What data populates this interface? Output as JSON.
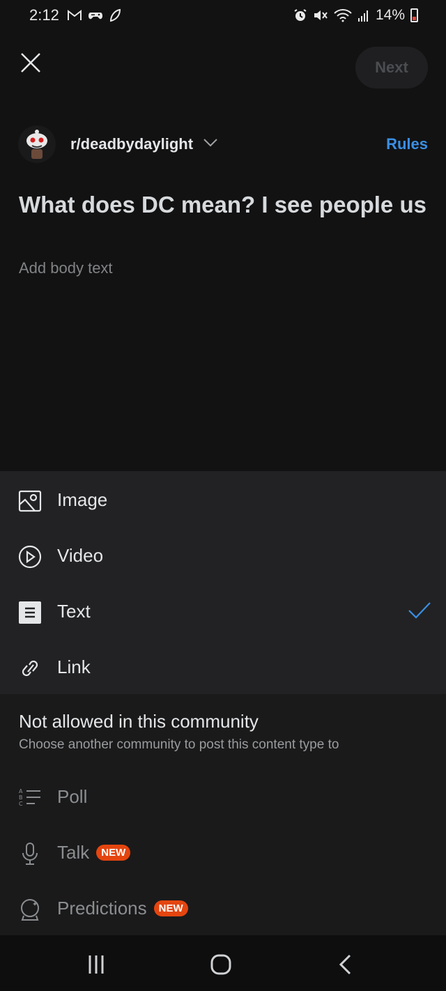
{
  "status_bar": {
    "time": "2:12",
    "battery_percent": "14%",
    "left_icons": [
      "gmail-icon",
      "game-controller-icon",
      "leaf-icon"
    ],
    "right_icons": [
      "alarm-icon",
      "mute-icon",
      "wifi-icon",
      "signal-icon",
      "battery-icon"
    ]
  },
  "header": {
    "close_icon": "close-icon",
    "next_label": "Next"
  },
  "community": {
    "name": "r/deadbydaylight",
    "rules_label": "Rules"
  },
  "post": {
    "title_value": "What does DC mean? I see people us",
    "body_placeholder": "Add body text"
  },
  "post_types": [
    {
      "label": "Image",
      "icon": "image-icon",
      "selected": false
    },
    {
      "label": "Video",
      "icon": "video-icon",
      "selected": false
    },
    {
      "label": "Text",
      "icon": "text-icon",
      "selected": true
    },
    {
      "label": "Link",
      "icon": "link-icon",
      "selected": false
    }
  ],
  "disallowed": {
    "title": "Not allowed in this community",
    "subtitle": "Choose another community to post this content type to",
    "items": [
      {
        "label": "Poll",
        "icon": "poll-icon"
      },
      {
        "label": "Talk",
        "icon": "microphone-icon",
        "badge": "NEW"
      },
      {
        "label": "Predictions",
        "icon": "crystal-ball-icon",
        "badge": "NEW"
      }
    ]
  },
  "colors": {
    "accent": "#3a8fe3",
    "badge": "#e4450f",
    "background": "#121213",
    "panel": "#222224"
  }
}
